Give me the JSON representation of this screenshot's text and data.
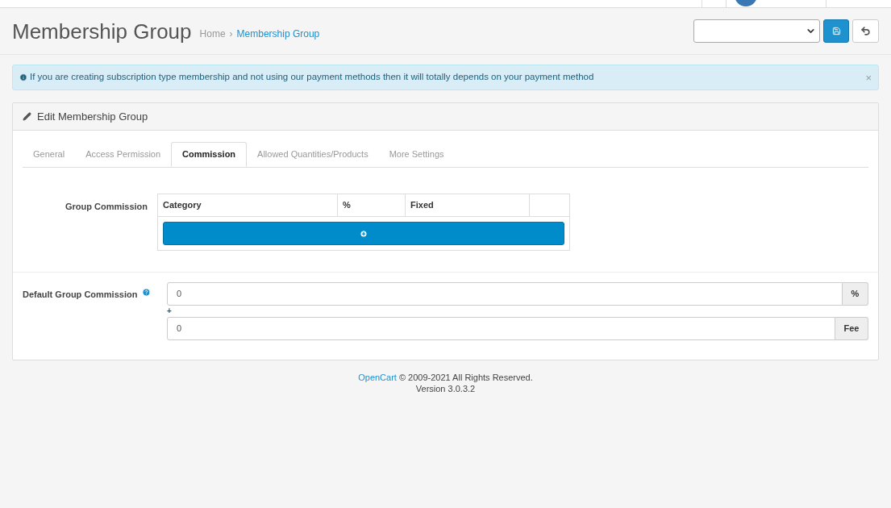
{
  "page": {
    "title": "Membership Group"
  },
  "breadcrumb_separator": "›",
  "breadcrumb": [
    {
      "label": "Home",
      "current": false
    },
    {
      "label": "Membership Group",
      "current": true
    }
  ],
  "alert": {
    "text": "If you are creating subscription type membership and not using our payment methods then it will totally depends on your payment method",
    "close": "×"
  },
  "panel": {
    "title": "Edit Membership Group"
  },
  "tabs": [
    {
      "label": "General",
      "selected": false
    },
    {
      "label": "Access Permission",
      "selected": false
    },
    {
      "label": "Commission",
      "selected": true
    },
    {
      "label": "Allowed Quantities/Products",
      "selected": false
    },
    {
      "label": "More Settings",
      "selected": false
    }
  ],
  "group_commission": {
    "label": "Group Commission",
    "columns": [
      "Category",
      "%",
      "Fixed"
    ]
  },
  "default_commission": {
    "label": "Default Group Commission",
    "percent_value": "0",
    "percent_addon": "%",
    "plus": "+",
    "fee_value": "0",
    "fee_addon": "Fee"
  },
  "footer": {
    "link": "OpenCart",
    "text": "© 2009-2021 All Rights Reserved.",
    "version": "Version 3.0.3.2"
  }
}
